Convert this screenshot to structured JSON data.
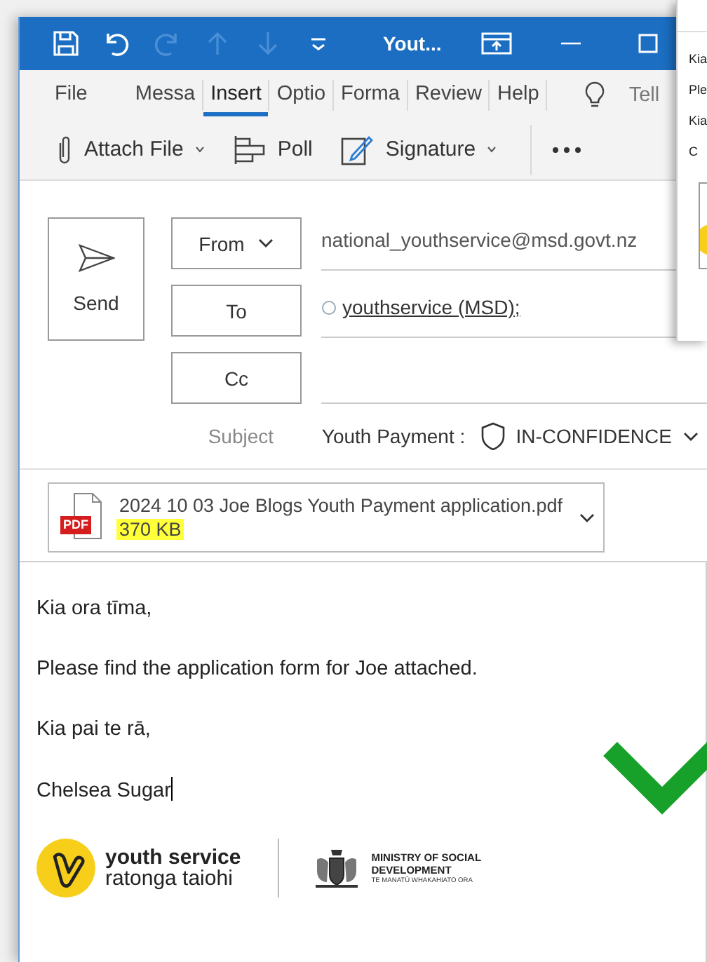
{
  "window": {
    "title": "Yout..."
  },
  "quick_access": [
    {
      "kind": "save",
      "disabled": false
    },
    {
      "kind": "undo",
      "disabled": false
    },
    {
      "kind": "redo",
      "disabled": true
    },
    {
      "kind": "up",
      "disabled": true
    },
    {
      "kind": "down",
      "disabled": true
    },
    {
      "kind": "customize",
      "disabled": false
    }
  ],
  "ribbon_tabs": [
    {
      "label": "File",
      "selected": false
    },
    {
      "label": "Messa",
      "selected": false
    },
    {
      "label": "Insert",
      "selected": true
    },
    {
      "label": "Optio",
      "selected": false
    },
    {
      "label": "Forma",
      "selected": false
    },
    {
      "label": "Review",
      "selected": false
    },
    {
      "label": "Help",
      "selected": false
    }
  ],
  "tell_me": "Tell",
  "ribbon_commands": [
    {
      "kind": "attach",
      "label": "Attach File",
      "dropdown": true
    },
    {
      "kind": "poll",
      "label": "Poll",
      "dropdown": false
    },
    {
      "kind": "signature",
      "label": "Signature",
      "dropdown": true
    }
  ],
  "header": {
    "send": "Send",
    "from_button": "From",
    "from_value": "national_youthservice@msd.govt.nz",
    "to_button": "To",
    "to_value": "youthservice (MSD);",
    "cc_button": "Cc",
    "subject_label": "Subject",
    "subject_value": "Youth Payment :",
    "classification": "IN-CONFIDENCE"
  },
  "attachment": {
    "file_type": "PDF",
    "name": "2024 10 03 Joe Blogs Youth Payment application.pdf",
    "size": "370 KB",
    "size_highlighted": true
  },
  "body": {
    "paragraphs": [
      "Kia ora tīma,",
      "Please find the application form for Joe attached.",
      "Kia pai te rā,",
      "Chelsea Sugar"
    ]
  },
  "signature": {
    "brand_line_1": "youth service",
    "brand_line_2": "ratonga taiohi",
    "ministry_line_1": "MINISTRY OF SOCIAL",
    "ministry_line_2": "DEVELOPMENT",
    "ministry_line_3": "TE MANATŪ WHAKAHIATO ORA"
  },
  "background_window": {
    "lines": [
      "Kia",
      "Ple",
      "Kia",
      "C"
    ]
  },
  "annotation": {
    "kind": "check"
  }
}
